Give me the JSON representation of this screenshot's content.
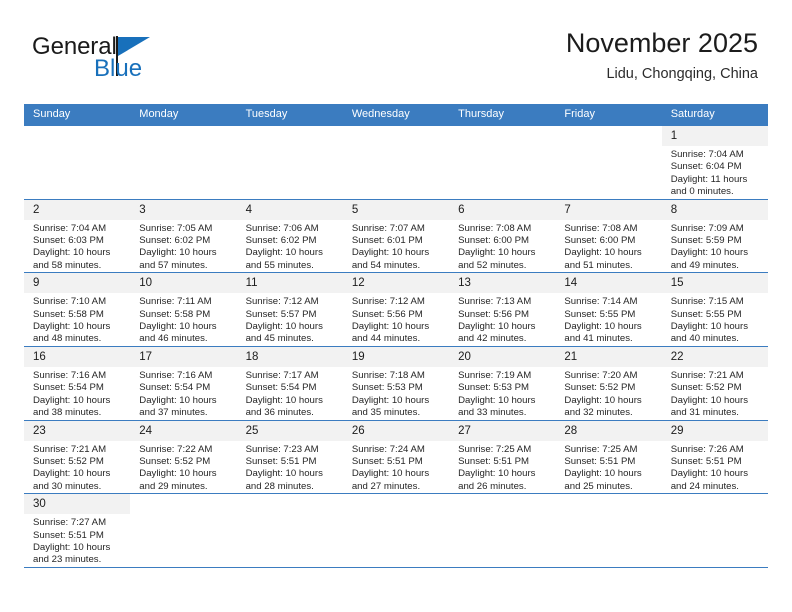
{
  "brand": {
    "name_part1": "General",
    "name_part2": "Blue"
  },
  "header": {
    "month_title": "November 2025",
    "location": "Lidu, Chongqing, China"
  },
  "colors": {
    "header_blue": "#3b7cc0",
    "logo_blue": "#1870bb",
    "daynum_bg": "#f2f2f2"
  },
  "weekdays": [
    "Sunday",
    "Monday",
    "Tuesday",
    "Wednesday",
    "Thursday",
    "Friday",
    "Saturday"
  ],
  "weeks": [
    [
      {
        "empty": true
      },
      {
        "empty": true
      },
      {
        "empty": true
      },
      {
        "empty": true
      },
      {
        "empty": true
      },
      {
        "empty": true
      },
      {
        "day": "1",
        "sunrise": "Sunrise: 7:04 AM",
        "sunset": "Sunset: 6:04 PM",
        "daylight1": "Daylight: 11 hours",
        "daylight2": "and 0 minutes."
      }
    ],
    [
      {
        "day": "2",
        "sunrise": "Sunrise: 7:04 AM",
        "sunset": "Sunset: 6:03 PM",
        "daylight1": "Daylight: 10 hours",
        "daylight2": "and 58 minutes."
      },
      {
        "day": "3",
        "sunrise": "Sunrise: 7:05 AM",
        "sunset": "Sunset: 6:02 PM",
        "daylight1": "Daylight: 10 hours",
        "daylight2": "and 57 minutes."
      },
      {
        "day": "4",
        "sunrise": "Sunrise: 7:06 AM",
        "sunset": "Sunset: 6:02 PM",
        "daylight1": "Daylight: 10 hours",
        "daylight2": "and 55 minutes."
      },
      {
        "day": "5",
        "sunrise": "Sunrise: 7:07 AM",
        "sunset": "Sunset: 6:01 PM",
        "daylight1": "Daylight: 10 hours",
        "daylight2": "and 54 minutes."
      },
      {
        "day": "6",
        "sunrise": "Sunrise: 7:08 AM",
        "sunset": "Sunset: 6:00 PM",
        "daylight1": "Daylight: 10 hours",
        "daylight2": "and 52 minutes."
      },
      {
        "day": "7",
        "sunrise": "Sunrise: 7:08 AM",
        "sunset": "Sunset: 6:00 PM",
        "daylight1": "Daylight: 10 hours",
        "daylight2": "and 51 minutes."
      },
      {
        "day": "8",
        "sunrise": "Sunrise: 7:09 AM",
        "sunset": "Sunset: 5:59 PM",
        "daylight1": "Daylight: 10 hours",
        "daylight2": "and 49 minutes."
      }
    ],
    [
      {
        "day": "9",
        "sunrise": "Sunrise: 7:10 AM",
        "sunset": "Sunset: 5:58 PM",
        "daylight1": "Daylight: 10 hours",
        "daylight2": "and 48 minutes."
      },
      {
        "day": "10",
        "sunrise": "Sunrise: 7:11 AM",
        "sunset": "Sunset: 5:58 PM",
        "daylight1": "Daylight: 10 hours",
        "daylight2": "and 46 minutes."
      },
      {
        "day": "11",
        "sunrise": "Sunrise: 7:12 AM",
        "sunset": "Sunset: 5:57 PM",
        "daylight1": "Daylight: 10 hours",
        "daylight2": "and 45 minutes."
      },
      {
        "day": "12",
        "sunrise": "Sunrise: 7:12 AM",
        "sunset": "Sunset: 5:56 PM",
        "daylight1": "Daylight: 10 hours",
        "daylight2": "and 44 minutes."
      },
      {
        "day": "13",
        "sunrise": "Sunrise: 7:13 AM",
        "sunset": "Sunset: 5:56 PM",
        "daylight1": "Daylight: 10 hours",
        "daylight2": "and 42 minutes."
      },
      {
        "day": "14",
        "sunrise": "Sunrise: 7:14 AM",
        "sunset": "Sunset: 5:55 PM",
        "daylight1": "Daylight: 10 hours",
        "daylight2": "and 41 minutes."
      },
      {
        "day": "15",
        "sunrise": "Sunrise: 7:15 AM",
        "sunset": "Sunset: 5:55 PM",
        "daylight1": "Daylight: 10 hours",
        "daylight2": "and 40 minutes."
      }
    ],
    [
      {
        "day": "16",
        "sunrise": "Sunrise: 7:16 AM",
        "sunset": "Sunset: 5:54 PM",
        "daylight1": "Daylight: 10 hours",
        "daylight2": "and 38 minutes."
      },
      {
        "day": "17",
        "sunrise": "Sunrise: 7:16 AM",
        "sunset": "Sunset: 5:54 PM",
        "daylight1": "Daylight: 10 hours",
        "daylight2": "and 37 minutes."
      },
      {
        "day": "18",
        "sunrise": "Sunrise: 7:17 AM",
        "sunset": "Sunset: 5:54 PM",
        "daylight1": "Daylight: 10 hours",
        "daylight2": "and 36 minutes."
      },
      {
        "day": "19",
        "sunrise": "Sunrise: 7:18 AM",
        "sunset": "Sunset: 5:53 PM",
        "daylight1": "Daylight: 10 hours",
        "daylight2": "and 35 minutes."
      },
      {
        "day": "20",
        "sunrise": "Sunrise: 7:19 AM",
        "sunset": "Sunset: 5:53 PM",
        "daylight1": "Daylight: 10 hours",
        "daylight2": "and 33 minutes."
      },
      {
        "day": "21",
        "sunrise": "Sunrise: 7:20 AM",
        "sunset": "Sunset: 5:52 PM",
        "daylight1": "Daylight: 10 hours",
        "daylight2": "and 32 minutes."
      },
      {
        "day": "22",
        "sunrise": "Sunrise: 7:21 AM",
        "sunset": "Sunset: 5:52 PM",
        "daylight1": "Daylight: 10 hours",
        "daylight2": "and 31 minutes."
      }
    ],
    [
      {
        "day": "23",
        "sunrise": "Sunrise: 7:21 AM",
        "sunset": "Sunset: 5:52 PM",
        "daylight1": "Daylight: 10 hours",
        "daylight2": "and 30 minutes."
      },
      {
        "day": "24",
        "sunrise": "Sunrise: 7:22 AM",
        "sunset": "Sunset: 5:52 PM",
        "daylight1": "Daylight: 10 hours",
        "daylight2": "and 29 minutes."
      },
      {
        "day": "25",
        "sunrise": "Sunrise: 7:23 AM",
        "sunset": "Sunset: 5:51 PM",
        "daylight1": "Daylight: 10 hours",
        "daylight2": "and 28 minutes."
      },
      {
        "day": "26",
        "sunrise": "Sunrise: 7:24 AM",
        "sunset": "Sunset: 5:51 PM",
        "daylight1": "Daylight: 10 hours",
        "daylight2": "and 27 minutes."
      },
      {
        "day": "27",
        "sunrise": "Sunrise: 7:25 AM",
        "sunset": "Sunset: 5:51 PM",
        "daylight1": "Daylight: 10 hours",
        "daylight2": "and 26 minutes."
      },
      {
        "day": "28",
        "sunrise": "Sunrise: 7:25 AM",
        "sunset": "Sunset: 5:51 PM",
        "daylight1": "Daylight: 10 hours",
        "daylight2": "and 25 minutes."
      },
      {
        "day": "29",
        "sunrise": "Sunrise: 7:26 AM",
        "sunset": "Sunset: 5:51 PM",
        "daylight1": "Daylight: 10 hours",
        "daylight2": "and 24 minutes."
      }
    ],
    [
      {
        "day": "30",
        "sunrise": "Sunrise: 7:27 AM",
        "sunset": "Sunset: 5:51 PM",
        "daylight1": "Daylight: 10 hours",
        "daylight2": "and 23 minutes."
      },
      {
        "empty": true
      },
      {
        "empty": true
      },
      {
        "empty": true
      },
      {
        "empty": true
      },
      {
        "empty": true
      },
      {
        "empty": true
      }
    ]
  ]
}
